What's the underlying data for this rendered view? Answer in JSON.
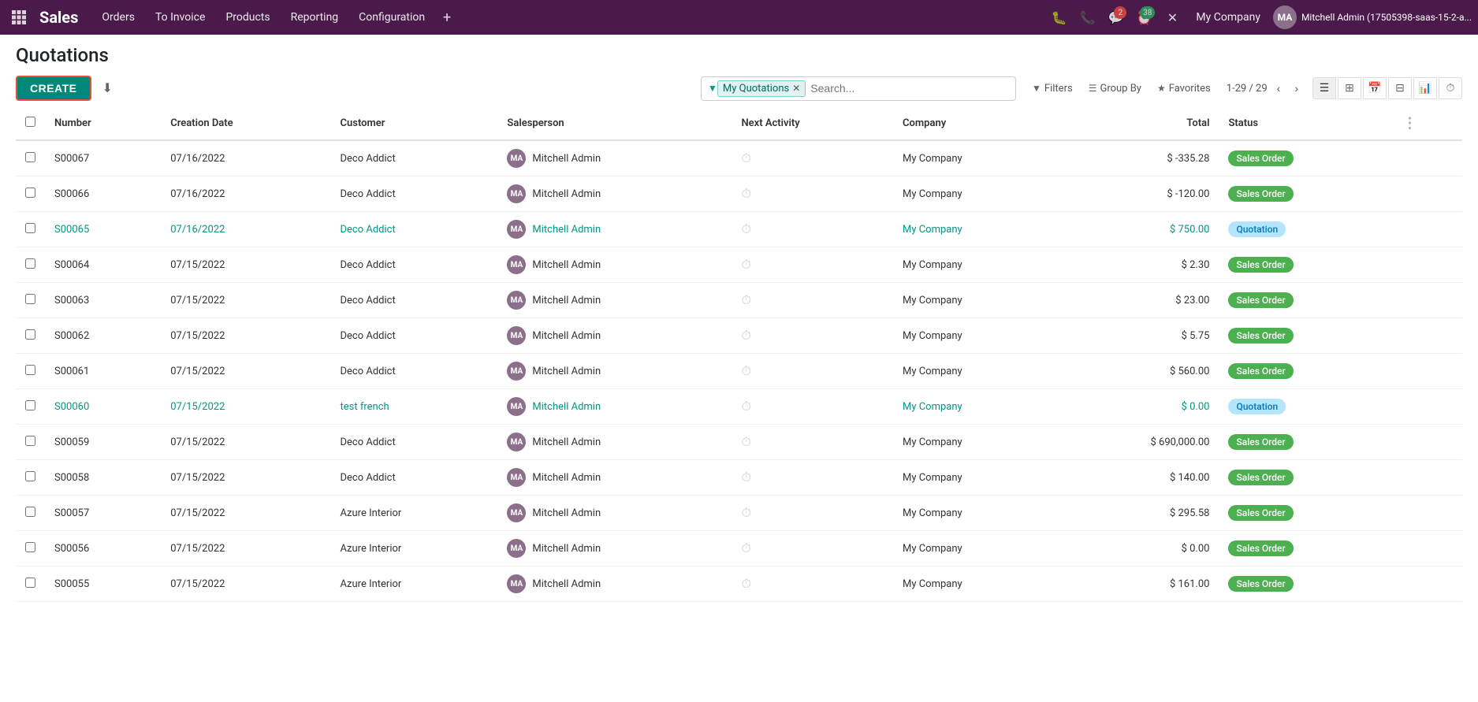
{
  "topnav": {
    "brand": "Sales",
    "menu_items": [
      "Orders",
      "To Invoice",
      "Products",
      "Reporting",
      "Configuration"
    ],
    "add_label": "+",
    "company": "My Company",
    "user_name": "Mitchell Admin (17505398-saas-15-2-a...",
    "user_initials": "MA",
    "badges": {
      "chat": "2",
      "activity": "38"
    }
  },
  "page": {
    "title": "Quotations",
    "create_label": "CREATE"
  },
  "search": {
    "filter_tag": "My Quotations",
    "placeholder": "Search..."
  },
  "toolbar": {
    "filters_label": "Filters",
    "group_by_label": "Group By",
    "favorites_label": "Favorites",
    "pagination": "1-29 / 29"
  },
  "table": {
    "columns": [
      "Number",
      "Creation Date",
      "Customer",
      "Salesperson",
      "Next Activity",
      "Company",
      "Total",
      "Status"
    ],
    "rows": [
      {
        "number": "S00067",
        "date": "07/16/2022",
        "customer": "Deco Addict",
        "salesperson": "Mitchell Admin",
        "company": "My Company",
        "total": "$ -335.28",
        "status": "Sales Order",
        "is_link": false
      },
      {
        "number": "S00066",
        "date": "07/16/2022",
        "customer": "Deco Addict",
        "salesperson": "Mitchell Admin",
        "company": "My Company",
        "total": "$ -120.00",
        "status": "Sales Order",
        "is_link": false
      },
      {
        "number": "S00065",
        "date": "07/16/2022",
        "customer": "Deco Addict",
        "salesperson": "Mitchell Admin",
        "company": "My Company",
        "total": "$ 750.00",
        "status": "Quotation",
        "is_link": true
      },
      {
        "number": "S00064",
        "date": "07/15/2022",
        "customer": "Deco Addict",
        "salesperson": "Mitchell Admin",
        "company": "My Company",
        "total": "$ 2.30",
        "status": "Sales Order",
        "is_link": false
      },
      {
        "number": "S00063",
        "date": "07/15/2022",
        "customer": "Deco Addict",
        "salesperson": "Mitchell Admin",
        "company": "My Company",
        "total": "$ 23.00",
        "status": "Sales Order",
        "is_link": false
      },
      {
        "number": "S00062",
        "date": "07/15/2022",
        "customer": "Deco Addict",
        "salesperson": "Mitchell Admin",
        "company": "My Company",
        "total": "$ 5.75",
        "status": "Sales Order",
        "is_link": false
      },
      {
        "number": "S00061",
        "date": "07/15/2022",
        "customer": "Deco Addict",
        "salesperson": "Mitchell Admin",
        "company": "My Company",
        "total": "$ 560.00",
        "status": "Sales Order",
        "is_link": false
      },
      {
        "number": "S00060",
        "date": "07/15/2022",
        "customer": "test french",
        "salesperson": "Mitchell Admin",
        "company": "My Company",
        "total": "$ 0.00",
        "status": "Quotation",
        "is_link": true
      },
      {
        "number": "S00059",
        "date": "07/15/2022",
        "customer": "Deco Addict",
        "salesperson": "Mitchell Admin",
        "company": "My Company",
        "total": "$ 690,000.00",
        "status": "Sales Order",
        "is_link": false
      },
      {
        "number": "S00058",
        "date": "07/15/2022",
        "customer": "Deco Addict",
        "salesperson": "Mitchell Admin",
        "company": "My Company",
        "total": "$ 140.00",
        "status": "Sales Order",
        "is_link": false
      },
      {
        "number": "S00057",
        "date": "07/15/2022",
        "customer": "Azure Interior",
        "salesperson": "Mitchell Admin",
        "company": "My Company",
        "total": "$ 295.58",
        "status": "Sales Order",
        "is_link": false
      },
      {
        "number": "S00056",
        "date": "07/15/2022",
        "customer": "Azure Interior",
        "salesperson": "Mitchell Admin",
        "company": "My Company",
        "total": "$ 0.00",
        "status": "Sales Order",
        "is_link": false
      },
      {
        "number": "S00055",
        "date": "07/15/2022",
        "customer": "Azure Interior",
        "salesperson": "Mitchell Admin",
        "company": "My Company",
        "total": "$ 161.00",
        "status": "Sales Order",
        "is_link": false
      }
    ]
  }
}
